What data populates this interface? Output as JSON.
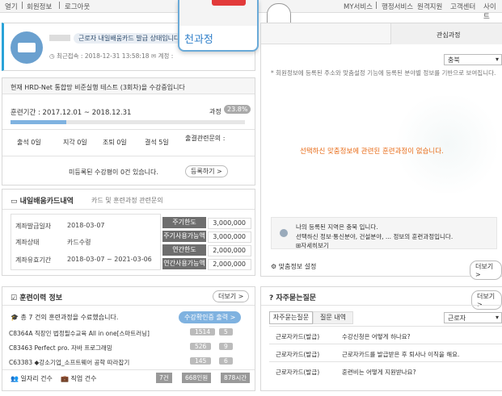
{
  "topbar": {
    "left": [
      "열기",
      "회원정보",
      "로그아웃"
    ],
    "right": [
      "MY서비스",
      "행정서비스",
      "원격지원",
      "고객센터",
      "사이트"
    ]
  },
  "profile": {
    "status_badge": "근로자 내일배움카드 발급 상태입니다",
    "last_login_label": "최근접속 : 2018-12-31 13:58:18",
    "account_label": "계정 :"
  },
  "zoom_popup": {
    "title": "천과정"
  },
  "course": {
    "notice": "현재 HRD-Net 통합망 비준실행 테스트 (3회차)을 수강중입니다",
    "period": "훈련기간 : 2017.12.01 ~ 2018.12.31",
    "progress_label": "과정",
    "progress_value": "23.8%",
    "progress_fraction": 0.238,
    "stats": [
      "출석 0일",
      "지각 0일",
      "조퇴 0일",
      "결석 5일"
    ],
    "attendance_query": "출결관련문의 :",
    "unregistered": "미등록된 수강평이 0건 있습니다.",
    "register_button": "등록하기 >"
  },
  "card": {
    "title": "내일배움카드내역",
    "subtitle": "카드 및 훈련과정 관련문의",
    "rows": [
      {
        "label": "계좌발급일자",
        "value": "2018-03-07"
      },
      {
        "label": "계좌상태",
        "value": "카드수령"
      },
      {
        "label": "계좌유효기간",
        "value": "2018-03-07 ~ 2021-03-06"
      }
    ],
    "limits": [
      {
        "label": "주기한도",
        "value": "3,000,000"
      },
      {
        "label": "주기사용가능액",
        "value": "3,000,000"
      },
      {
        "label": "연간한도",
        "value": "2,000,000"
      },
      {
        "label": "연간사용가능액",
        "value": "2,000,000"
      }
    ]
  },
  "history": {
    "title": "훈련이력 정보",
    "more": "더보기 >",
    "summary": "총 7 건의 훈련과정을 수료했습니다.",
    "cert_button": "수강확인증 출력 >",
    "items": [
      {
        "name": "C8364A 직장인 법정필수교육 All in one[스마트러닝]",
        "a": "1514",
        "b": "5"
      },
      {
        "name": "C83463 Perfect pro. 자바 프로그래밍",
        "a": "526",
        "b": "9"
      },
      {
        "name": "C63383 ◆강소기업_소프트웨어 공학 따라잡기",
        "a": "145",
        "b": "6"
      }
    ],
    "footer_left": "일자리 건수",
    "footer_mid": "직업 건수",
    "footer_vals": [
      "7건",
      "668인원",
      "878시간"
    ]
  },
  "tabs": {
    "recommended": "관심과정",
    "region_select": "충북",
    "notice": "* 회원정보에 등록된 주소와 맞춤설정 기능에 등록된 분야별 정보를 기반으로 보여집니다.",
    "empty_message": "선택하신 맞춤정보에 관련된 훈련과정이 없습니다.",
    "region_line1": "나의 등록된 지역은 충북 입니다.",
    "region_line2": "선택하신 정보·통신분야, 건설분야, ... 정보의 훈련과정입니다.",
    "detail_link": "자세히보기",
    "settings": "맞춤정보 설정",
    "more": "더보기 >"
  },
  "faq": {
    "title": "자주묻는질문",
    "more": "더보기 >",
    "tab1": "자주묻는질문",
    "tab2": "질문 내역",
    "select": "근로자",
    "rows": [
      {
        "cat": "근로자카드(발급)",
        "q": "수강신청은 어떻게 하나요?"
      },
      {
        "cat": "근로자카드(발급)",
        "q": "근로자카드를 발급받은 후 퇴사나 이직을 해요."
      },
      {
        "cat": "근로자카드(발급)",
        "q": "훈련비는 어떻게 지원받나요?"
      }
    ]
  }
}
